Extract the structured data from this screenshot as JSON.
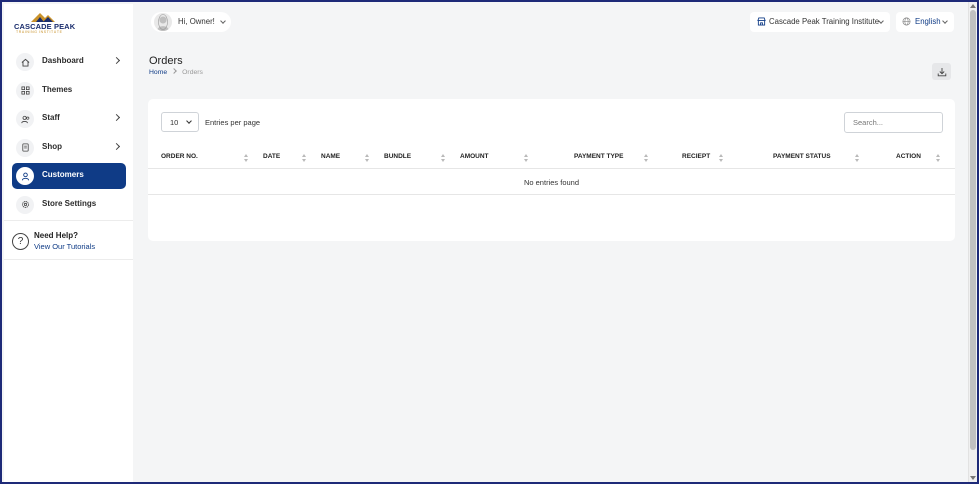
{
  "logo": {
    "brand": "CASCADE PEAK",
    "tagline": "TRAINING INSTITUTE"
  },
  "sidebar": {
    "items": [
      {
        "label": "Dashboard",
        "icon": "home-icon",
        "has_chevron": true,
        "active": false
      },
      {
        "label": "Themes",
        "icon": "themes-icon",
        "has_chevron": false,
        "active": false
      },
      {
        "label": "Staff",
        "icon": "staff-icon",
        "has_chevron": true,
        "active": false
      },
      {
        "label": "Shop",
        "icon": "shop-icon",
        "has_chevron": true,
        "active": false
      },
      {
        "label": "Customers",
        "icon": "user-icon",
        "has_chevron": false,
        "active": true
      },
      {
        "label": "Store Settings",
        "icon": "settings-icon",
        "has_chevron": false,
        "active": false
      }
    ],
    "help": {
      "title": "Need Help?",
      "link": "View Our Tutorials",
      "icon": "question-icon"
    }
  },
  "header": {
    "greeting": "Hi, Owner!",
    "institute": "Cascade Peak Training Institute",
    "language": "English"
  },
  "page": {
    "title": "Orders",
    "breadcrumb": {
      "home": "Home",
      "current": "Orders"
    }
  },
  "table": {
    "entries_value": "10",
    "entries_label": "Entries per page",
    "search_placeholder": "Search...",
    "columns": [
      "ORDER NO.",
      "DATE",
      "NAME",
      "BUNDLE",
      "AMOUNT",
      "PAYMENT TYPE",
      "RECIEPT",
      "PAYMENT STATUS",
      "ACTION"
    ],
    "empty_message": "No entries found"
  },
  "colors": {
    "brand": "#0f3b86",
    "frame_border": "#1e2a78",
    "background": "#f4f5f6"
  }
}
